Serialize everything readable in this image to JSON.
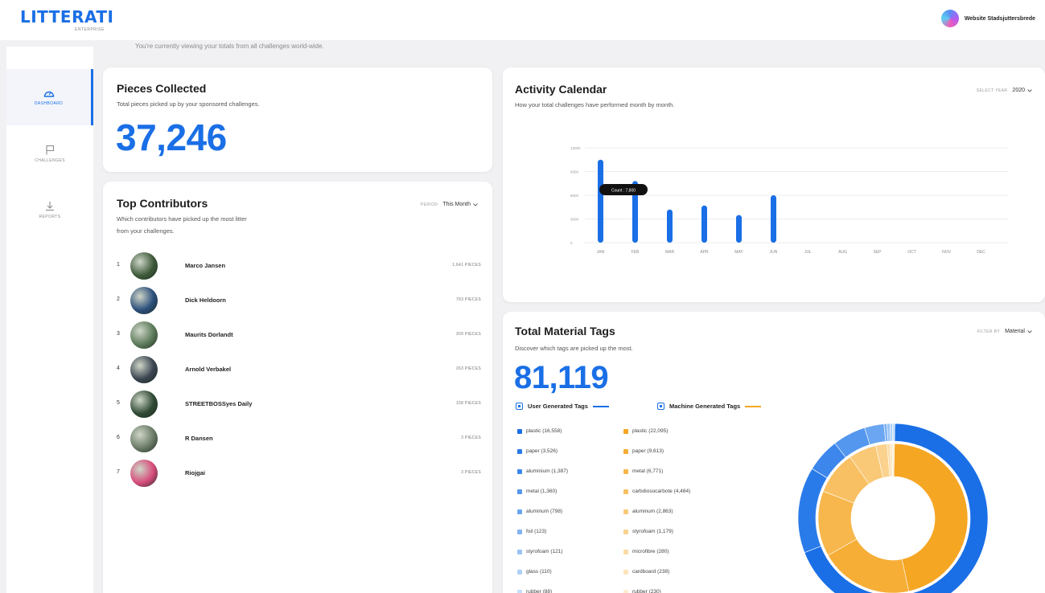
{
  "brand": {
    "name": "LITTERATI",
    "subtitle": "ENTERPRISE"
  },
  "user": {
    "name": "Website Stadsjuttersbrede"
  },
  "sidebar": {
    "items": [
      {
        "label": "DASHBOARD",
        "icon": "gauge-icon",
        "active": true
      },
      {
        "label": "CHALLENGES",
        "icon": "flag-icon",
        "active": false
      },
      {
        "label": "REPORTS",
        "icon": "download-icon",
        "active": false
      }
    ]
  },
  "subheader": "You're currently viewing your totals from all challenges world-wide.",
  "pieces_collected": {
    "title": "Pieces Collected",
    "description": "Total pieces picked up by your sponsored challenges.",
    "value": "37,246"
  },
  "top_contributors": {
    "title": "Top Contributors",
    "description_line1": "Which contributors have picked up the most litter",
    "description_line2": "from your challenges.",
    "filter_label": "PERIOD",
    "filter_value": "This Month",
    "rows": [
      {
        "rank": "1",
        "name": "Marco Jansen",
        "pieces": "1,641 PIECES",
        "avatar_color": "#3e5a3a"
      },
      {
        "rank": "2",
        "name": "Dick Heldoorn",
        "pieces": "763 PIECES",
        "avatar_color": "#2b4f7a"
      },
      {
        "rank": "3",
        "name": "Maurits Dorlandt",
        "pieces": "309 PIECES",
        "avatar_color": "#5c7a5a"
      },
      {
        "rank": "4",
        "name": "Arnold Verbakel",
        "pieces": "263 PIECES",
        "avatar_color": "#3a4450"
      },
      {
        "rank": "5",
        "name": "STREETBOSSyes Daily",
        "pieces": "158 PIECES",
        "avatar_color": "#2f4a34"
      },
      {
        "rank": "6",
        "name": "R Dansen",
        "pieces": "3 PIECES",
        "avatar_color": "#6a7a66"
      },
      {
        "rank": "7",
        "name": "Riojgai",
        "pieces": "3 PIECES",
        "avatar_color": "#d64b7a"
      }
    ]
  },
  "activity_calendar": {
    "title": "Activity Calendar",
    "description": "How your total challenges have performed month by month.",
    "filter_label": "SELECT YEAR",
    "filter_value": "2020",
    "tooltip": "Count : 7,800"
  },
  "chart_data": {
    "type": "bar",
    "categories": [
      "JAN",
      "FEB",
      "MAR",
      "APR",
      "MAY",
      "JUN",
      "JUL",
      "AUG",
      "SEP",
      "OCT",
      "NOV",
      "DEC"
    ],
    "values": [
      10500,
      7800,
      4200,
      4700,
      3500,
      6000,
      0,
      0,
      0,
      0,
      0,
      0
    ],
    "ylim": [
      0,
      12000
    ],
    "yticks": [
      "0",
      "3000",
      "6000",
      "9000",
      "12000"
    ],
    "grid": true
  },
  "material_tags": {
    "title": "Total Material Tags",
    "description": "Discover which tags are picked up the most.",
    "filter_label": "FILTER BY",
    "filter_value": "Material",
    "value": "81,119",
    "legend_user": "User Generated Tags",
    "legend_machine": "Machine Generated Tags",
    "user_tags": [
      {
        "label": "plastic (16,558)",
        "color": "#1a6fe6"
      },
      {
        "label": "paper (3,526)",
        "color": "#2a7bea"
      },
      {
        "label": "aluminium (1,387)",
        "color": "#3d87ec"
      },
      {
        "label": "metal (1,360)",
        "color": "#5497ef"
      },
      {
        "label": "aluminum (798)",
        "color": "#6aa6f1"
      },
      {
        "label": "foil (123)",
        "color": "#80b4f3"
      },
      {
        "label": "styrofoam (121)",
        "color": "#97c3f5"
      },
      {
        "label": "glass (110)",
        "color": "#aed1f7"
      },
      {
        "label": "rubber (88)",
        "color": "#c5dff9"
      }
    ],
    "machine_tags": [
      {
        "label": "plastic (22,095)",
        "color": "#f5a623"
      },
      {
        "label": "paper (9,613)",
        "color": "#f6ae37"
      },
      {
        "label": "metal (6,771)",
        "color": "#f7b74c"
      },
      {
        "label": "carbdiosocarbote (4,484)",
        "color": "#f8c062"
      },
      {
        "label": "aluminum (2,863)",
        "color": "#f9c978"
      },
      {
        "label": "styrofoam (1,179)",
        "color": "#fad28e"
      },
      {
        "label": "microfibre (280)",
        "color": "#fbdba4"
      },
      {
        "label": "cardboard (238)",
        "color": "#fce4ba"
      },
      {
        "label": "rubber (230)",
        "color": "#fdedd0"
      }
    ],
    "colors": {
      "user": "#1a6fe6",
      "machine": "#f5a623"
    }
  }
}
